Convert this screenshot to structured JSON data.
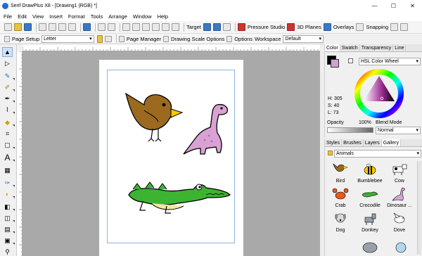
{
  "window": {
    "title": "Serif DrawPlus X8 - [Drawing1 (RGB) *]",
    "minimize": "—",
    "maximize": "☐",
    "close": "✕"
  },
  "menu": [
    "File",
    "Edit",
    "View",
    "Insert",
    "Format",
    "Tools",
    "Arrange",
    "Window",
    "Help"
  ],
  "toolbar1": {
    "target_label": "Target",
    "pressure_label": "Pressure Studio",
    "planes_label": "3D Planes",
    "overlays_label": "Overlays",
    "snapping_label": "Snapping"
  },
  "toolbar2": {
    "page_setup_label": "Page Setup",
    "page_size_value": "Letter",
    "page_manager_label": "Page Manager",
    "drawing_scale_label": "Drawing Scale Options",
    "options_label": "Options",
    "workspace_label": "Workspace",
    "workspace_value": "Default"
  },
  "color_panel": {
    "tabs": [
      "Color",
      "Swatch",
      "Transparency",
      "Line"
    ],
    "mode_value": "HSL Color Wheel",
    "h_label": "H: 305",
    "s_label": "S: 40",
    "l_label": "L: 73",
    "opacity_label": "Opacity",
    "opacity_value": "100%",
    "blend_label": "Blend Mode",
    "blend_value": "Normal",
    "selected_color": "#d59fd0"
  },
  "gallery_panel": {
    "tabs": [
      "Styles",
      "Brushes",
      "Layers",
      "Gallery"
    ],
    "category_value": "Animals",
    "items": [
      {
        "label": "Bird"
      },
      {
        "label": "Bumblebee"
      },
      {
        "label": "Cow"
      },
      {
        "label": "Crab"
      },
      {
        "label": "Crocodile"
      },
      {
        "label": "Dinosaur ..."
      },
      {
        "label": "Dog"
      },
      {
        "label": "Donkey"
      },
      {
        "label": "Dove"
      }
    ]
  }
}
